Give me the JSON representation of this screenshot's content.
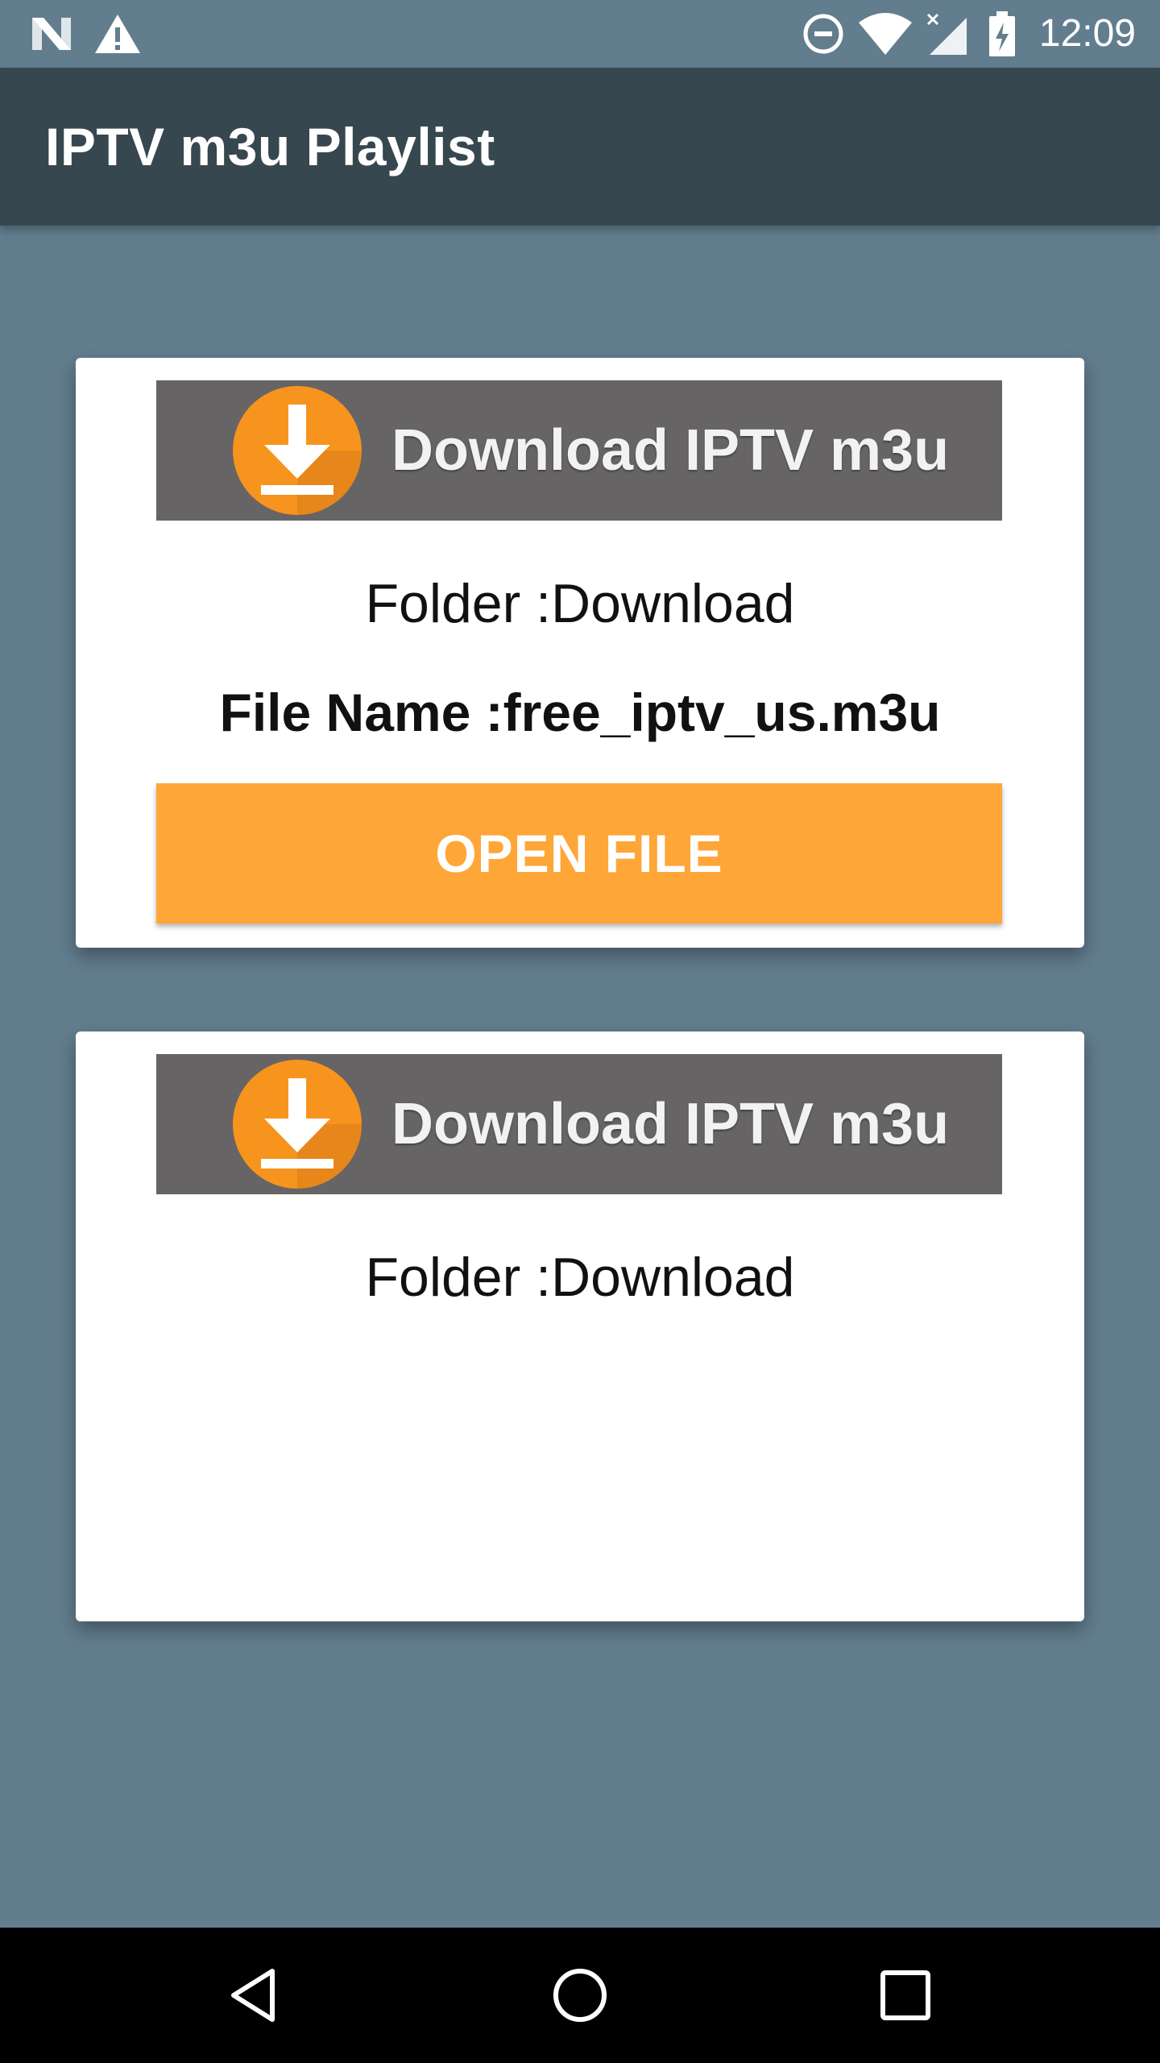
{
  "status_bar": {
    "time": "12:09",
    "icons": [
      "n-icon",
      "warning-icon",
      "do-not-disturb-icon",
      "wifi-icon",
      "signal-icon",
      "battery-icon"
    ]
  },
  "app_bar": {
    "title": "IPTV m3u Playlist"
  },
  "cards": [
    {
      "banner_text": "Download IPTV m3u",
      "folder": "Folder :Download",
      "file_name": "File Name :free_iptv_us.m3u",
      "button_label": "OPEN FILE"
    },
    {
      "banner_text": "Download IPTV m3u",
      "folder": "Folder :Download"
    }
  ],
  "nav_bar": {
    "buttons": [
      "back-icon",
      "home-icon",
      "recents-icon"
    ]
  },
  "colors": {
    "background": "#627d8e",
    "app_bar": "#37474f",
    "banner": "#676466",
    "accent": "#fea637",
    "icon_orange": "#f7941d"
  }
}
